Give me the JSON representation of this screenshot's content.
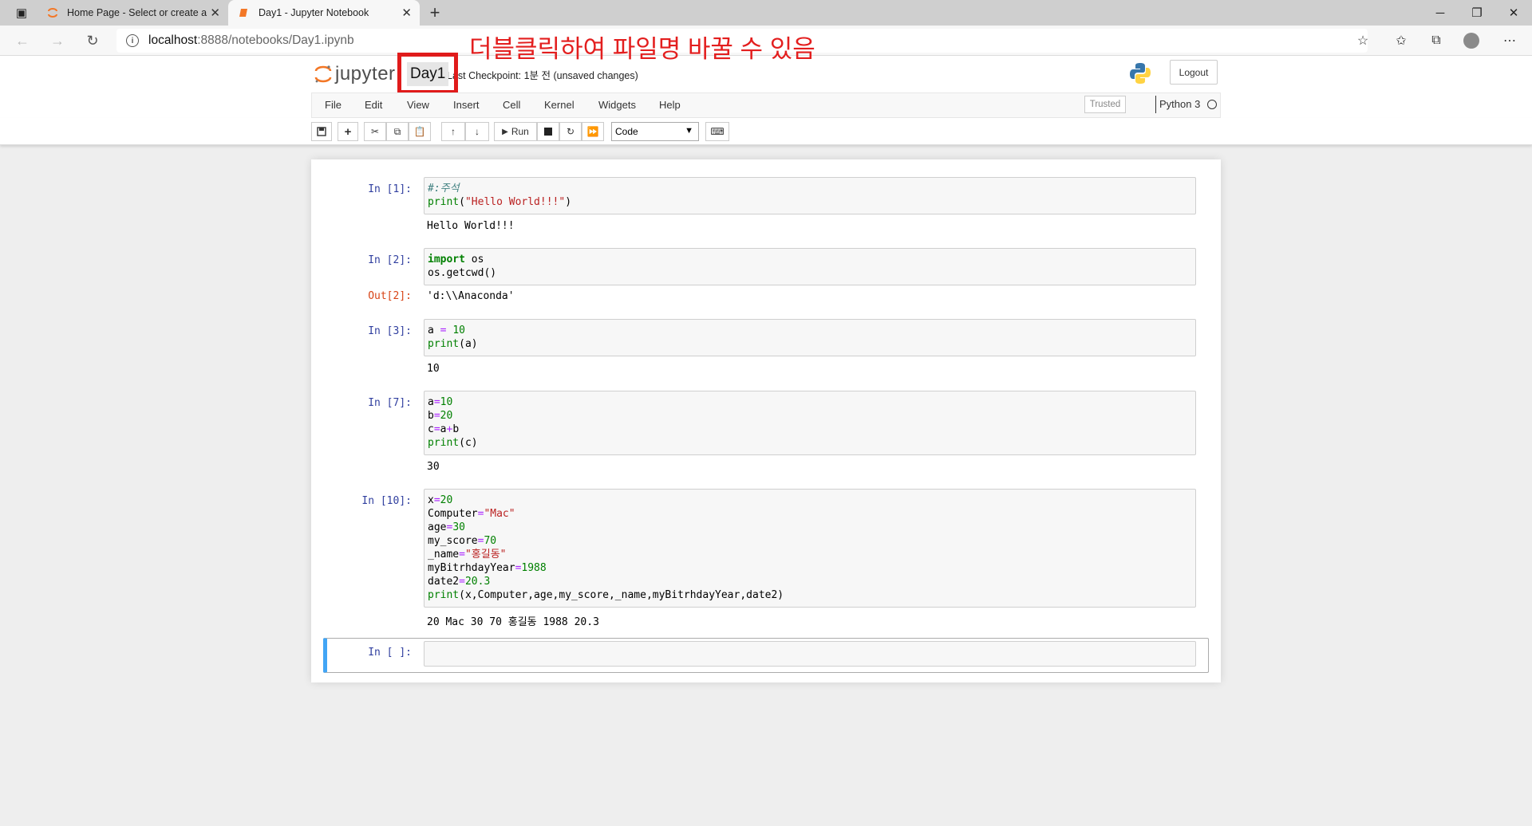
{
  "browser": {
    "tabs": [
      {
        "title": "Home Page - Select or create a notebook",
        "active": false
      },
      {
        "title": "Day1 - Jupyter Notebook",
        "active": true
      }
    ],
    "url_host": "localhost",
    "url_path": ":8888/notebooks/Day1.ipynb"
  },
  "header": {
    "logo_text": "jupyter",
    "notebook_name": "Day1",
    "checkpoint_text": "Last Checkpoint: 1분 전  (unsaved changes)",
    "logout_label": "Logout"
  },
  "annotation": {
    "text": "더블클릭하여 파일명 바꿀 수 있음",
    "color": "#e01b1b"
  },
  "menu": {
    "items": [
      "File",
      "Edit",
      "View",
      "Insert",
      "Cell",
      "Kernel",
      "Widgets",
      "Help"
    ],
    "trusted_label": "Trusted",
    "kernel_name": "Python 3"
  },
  "toolbar": {
    "run_label": "Run",
    "cell_type": "Code"
  },
  "cells": [
    {
      "prompt": "In [1]:",
      "lines": [
        "#:주석",
        "print(\"Hello World!!!\")"
      ],
      "output_prompt": "",
      "output": "Hello World!!!"
    },
    {
      "prompt": "In [2]:",
      "lines": [
        "import os",
        "os.getcwd()"
      ],
      "output_prompt": "Out[2]:",
      "output": "'d:\\\\Anaconda'"
    },
    {
      "prompt": "In [3]:",
      "lines": [
        "a = 10",
        "print(a)"
      ],
      "output_prompt": "",
      "output": "10"
    },
    {
      "prompt": "In [7]:",
      "lines": [
        "a=10",
        "b=20",
        "c=a+b",
        "print(c)"
      ],
      "output_prompt": "",
      "output": "30"
    },
    {
      "prompt": "In [10]:",
      "lines": [
        "x=20",
        "Computer=\"Mac\"",
        "age=30",
        "my_score=70",
        "_name=\"홍길동\"",
        "myBitrhdayYear=1988",
        "date2=20.3",
        "print(x,Computer,age,my_score,_name,myBitrhdayYear,date2)"
      ],
      "output_prompt": "",
      "output": "20 Mac 30 70 홍길동 1988 20.3"
    }
  ],
  "empty_cell_prompt": "In [ ]:"
}
